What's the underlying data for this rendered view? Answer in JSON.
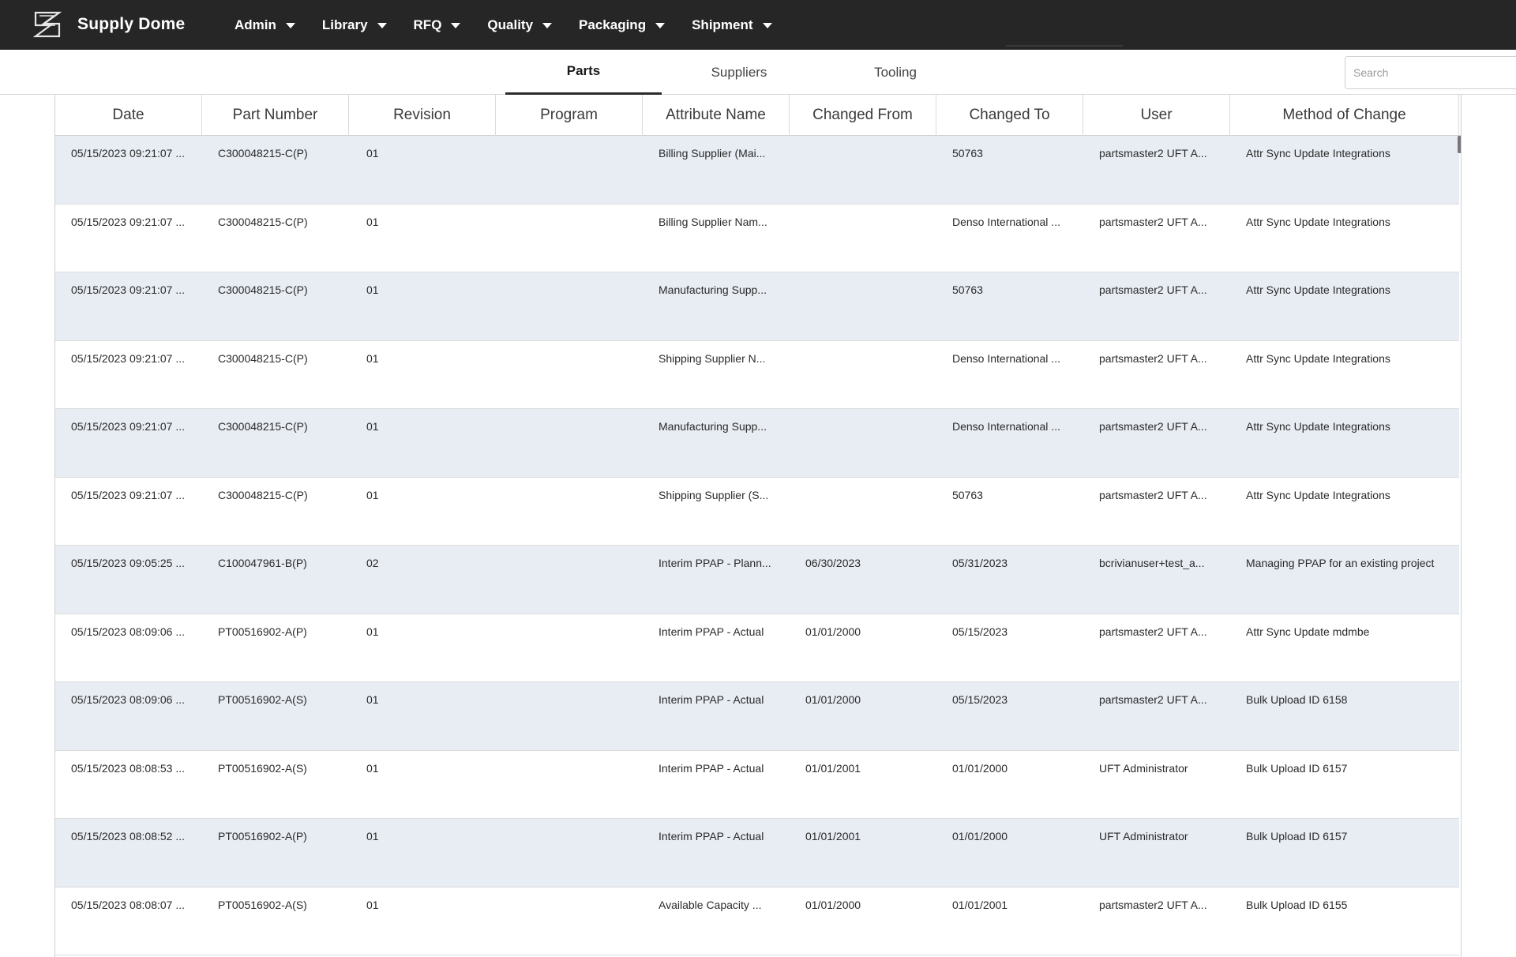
{
  "app": {
    "name": "Supply Dome"
  },
  "nav": [
    {
      "label": "Admin"
    },
    {
      "label": "Library"
    },
    {
      "label": "RFQ"
    },
    {
      "label": "Quality"
    },
    {
      "label": "Packaging"
    },
    {
      "label": "Shipment"
    }
  ],
  "tabs": [
    {
      "label": "Parts",
      "active": true
    },
    {
      "label": "Suppliers",
      "active": false
    },
    {
      "label": "Tooling",
      "active": false
    }
  ],
  "search": {
    "placeholder": "Search",
    "value": ""
  },
  "table": {
    "columns": [
      "Date",
      "Part Number",
      "Revision",
      "Program",
      "Attribute Name",
      "Changed From",
      "Changed To",
      "User",
      "Method of Change"
    ],
    "rows": [
      [
        "05/15/2023 09:21:07 ...",
        "C300048215-C(P)",
        "01",
        "",
        "Billing Supplier (Mai...",
        "",
        "50763",
        "partsmaster2 UFT A...",
        "Attr Sync Update Integrations"
      ],
      [
        "05/15/2023 09:21:07 ...",
        "C300048215-C(P)",
        "01",
        "",
        "Billing Supplier Nam...",
        "",
        "Denso International ...",
        "partsmaster2 UFT A...",
        "Attr Sync Update Integrations"
      ],
      [
        "05/15/2023 09:21:07 ...",
        "C300048215-C(P)",
        "01",
        "",
        "Manufacturing Supp...",
        "",
        "50763",
        "partsmaster2 UFT A...",
        "Attr Sync Update Integrations"
      ],
      [
        "05/15/2023 09:21:07 ...",
        "C300048215-C(P)",
        "01",
        "",
        "Shipping Supplier N...",
        "",
        "Denso International ...",
        "partsmaster2 UFT A...",
        "Attr Sync Update Integrations"
      ],
      [
        "05/15/2023 09:21:07 ...",
        "C300048215-C(P)",
        "01",
        "",
        "Manufacturing Supp...",
        "",
        "Denso International ...",
        "partsmaster2 UFT A...",
        "Attr Sync Update Integrations"
      ],
      [
        "05/15/2023 09:21:07 ...",
        "C300048215-C(P)",
        "01",
        "",
        "Shipping Supplier (S...",
        "",
        "50763",
        "partsmaster2 UFT A...",
        "Attr Sync Update Integrations"
      ],
      [
        "05/15/2023 09:05:25 ...",
        "C100047961-B(P)",
        "02",
        "",
        "Interim PPAP - Plann...",
        "06/30/2023",
        "05/31/2023",
        "bcrivianuser+test_a...",
        "Managing PPAP for an existing project"
      ],
      [
        "05/15/2023 08:09:06 ...",
        "PT00516902-A(P)",
        "01",
        "",
        "Interim PPAP - Actual",
        "01/01/2000",
        "05/15/2023",
        "partsmaster2 UFT A...",
        "Attr Sync Update mdmbe"
      ],
      [
        "05/15/2023 08:09:06 ...",
        "PT00516902-A(S)",
        "01",
        "",
        "Interim PPAP - Actual",
        "01/01/2000",
        "05/15/2023",
        "partsmaster2 UFT A...",
        "Bulk Upload ID 6158"
      ],
      [
        "05/15/2023 08:08:53 ...",
        "PT00516902-A(S)",
        "01",
        "",
        "Interim PPAP - Actual",
        "01/01/2001",
        "01/01/2000",
        "UFT Administrator",
        "Bulk Upload ID 6157"
      ],
      [
        "05/15/2023 08:08:52 ...",
        "PT00516902-A(P)",
        "01",
        "",
        "Interim PPAP - Actual",
        "01/01/2001",
        "01/01/2000",
        "UFT Administrator",
        "Bulk Upload ID 6157"
      ],
      [
        "05/15/2023 08:08:07 ...",
        "PT00516902-A(S)",
        "01",
        "",
        "Available Capacity ...",
        "01/01/2000",
        "01/01/2001",
        "partsmaster2 UFT A...",
        "Bulk Upload ID 6155"
      ]
    ]
  },
  "colors": {
    "topbar": "#262626",
    "row_alt": "#e8edf4"
  }
}
